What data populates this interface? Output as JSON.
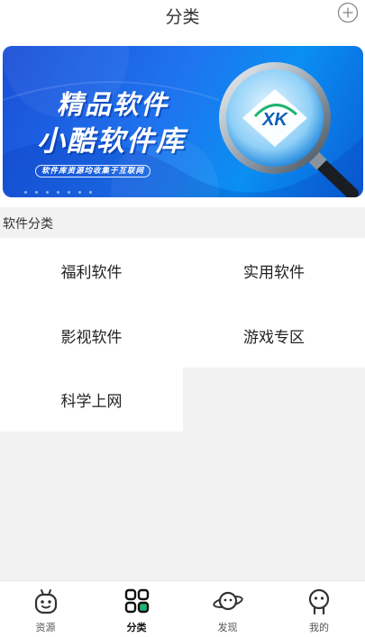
{
  "header": {
    "title": "分类"
  },
  "banner": {
    "line1": "精品软件",
    "line2": "小酷软件库",
    "tagline": "软件库资源均收集于互联网",
    "logo_text": "XK"
  },
  "section": {
    "label": "软件分类"
  },
  "categories": [
    {
      "label": "福利软件"
    },
    {
      "label": "实用软件"
    },
    {
      "label": "影视软件"
    },
    {
      "label": "游戏专区"
    },
    {
      "label": "科学上网"
    }
  ],
  "tabbar": {
    "active": "分类",
    "items": [
      {
        "label": "资源",
        "icon": "resource-face-icon"
      },
      {
        "label": "分类",
        "icon": "grid-icon"
      },
      {
        "label": "发现",
        "icon": "planet-icon"
      },
      {
        "label": "我的",
        "icon": "user-icon"
      }
    ]
  },
  "colors": {
    "banner_blue": "#1f74ef",
    "accent_green": "#1fb472"
  }
}
